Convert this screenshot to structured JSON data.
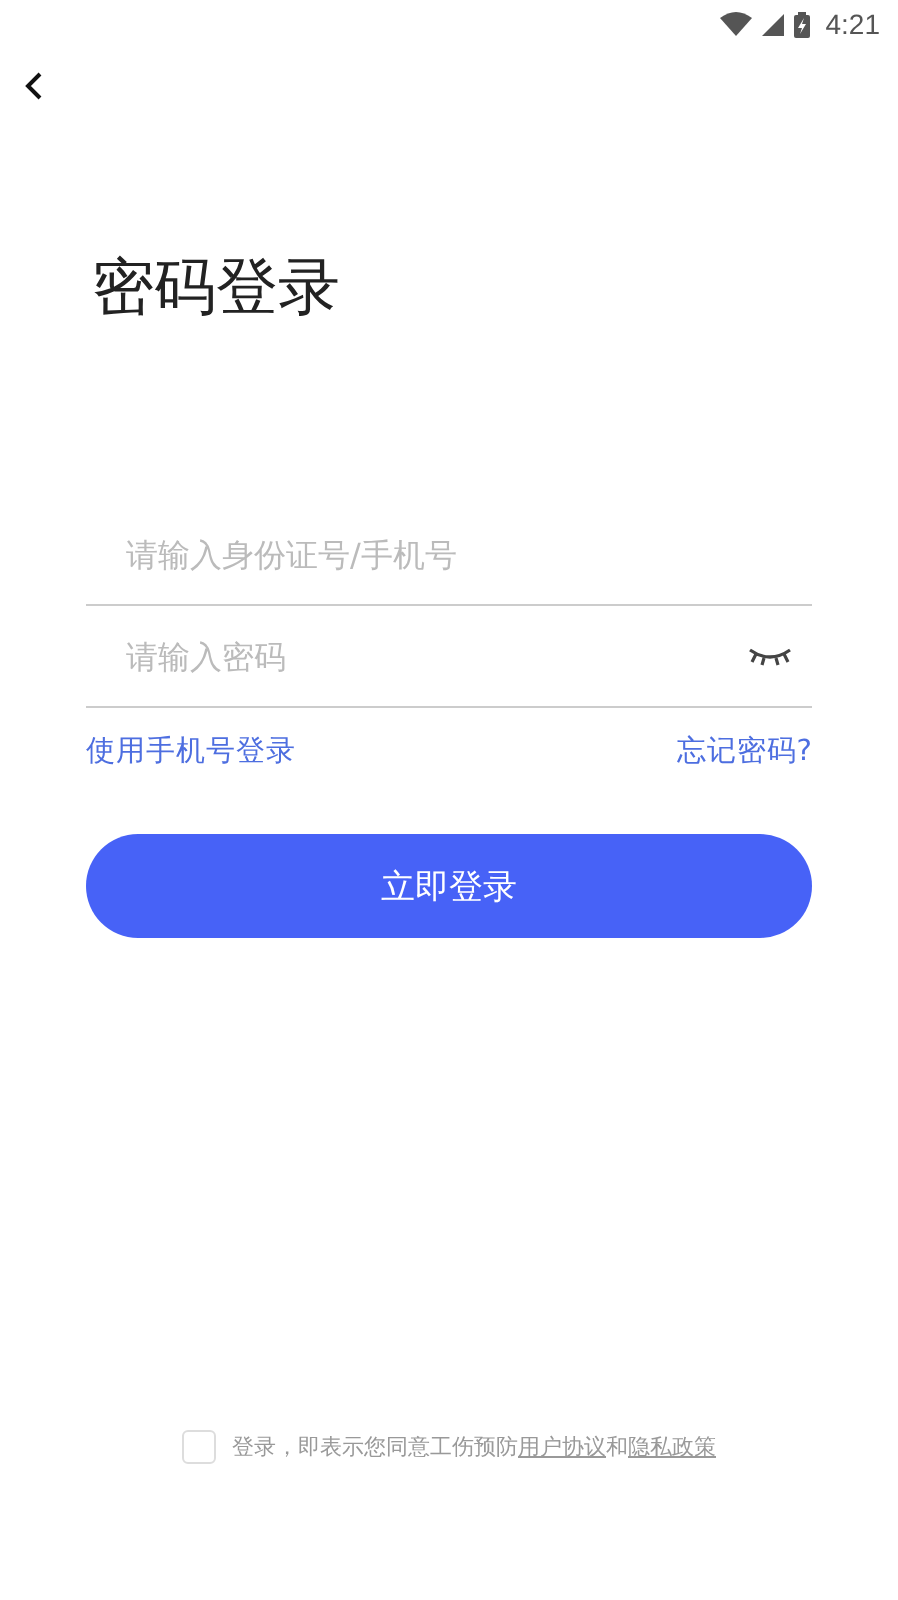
{
  "status_bar": {
    "time": "4:21"
  },
  "title": "密码登录",
  "fields": [
    {
      "placeholder": "请输入身份证号/手机号",
      "kind": "text"
    },
    {
      "placeholder": "请输入密码",
      "kind": "password"
    }
  ],
  "links": {
    "left": "使用手机号登录",
    "right": "忘记密码?"
  },
  "login_button": "立即登录",
  "agreement": {
    "checked": false,
    "parts": [
      {
        "kind": "text",
        "text": "登录，即表示您同意工伤预防"
      },
      {
        "kind": "link",
        "text": "用户协议"
      },
      {
        "kind": "text",
        "text": "和"
      },
      {
        "kind": "link",
        "text": "隐私政策"
      }
    ]
  }
}
